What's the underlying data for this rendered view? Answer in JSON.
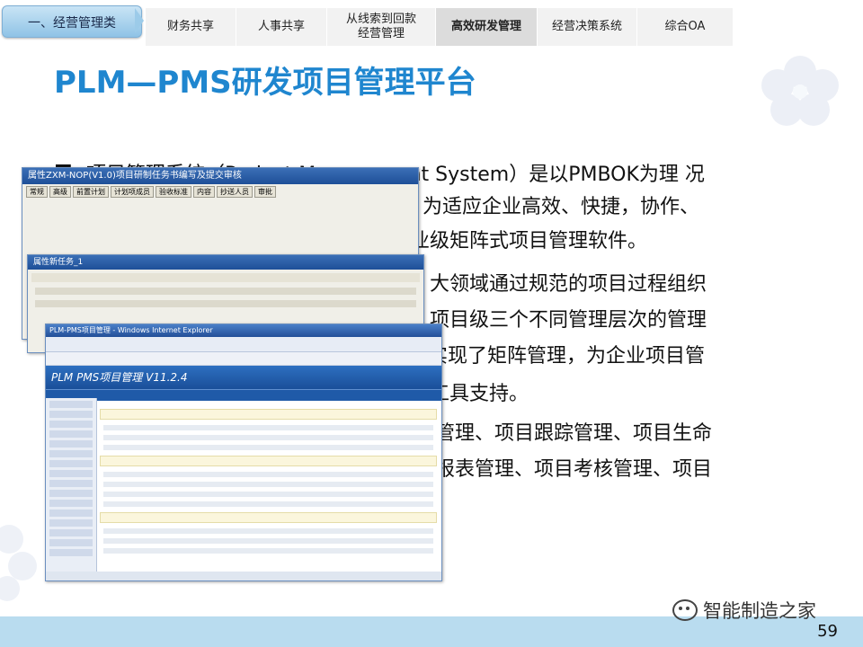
{
  "nav": {
    "section_label": "一、经营管理类",
    "tabs": [
      {
        "label": "财务共享"
      },
      {
        "label": "人事共享"
      },
      {
        "label": "从线索到回款\n经营管理"
      },
      {
        "label": "高效研发管理"
      },
      {
        "label": "经营决策系统"
      },
      {
        "label": "综合OA"
      }
    ],
    "active_tab": "高效研发管理"
  },
  "title": "PLM—PMS研发项目管理平台",
  "body": {
    "bullet": "■",
    "lines": [
      "项目管理系统（Project Management System）是以PMBOK为理 况",
      "为适应企业高效、快捷，协作、",
      "业级矩阵式项目管理软件。",
      "大领域通过规范的项目过程组织",
      "项目级三个不同管理层次的管理",
      "实现了矩阵管理，为企业项目管",
      "工具支持。",
      "管理、项目跟踪管理、项目生命",
      "报表管理、项目考核管理、项目"
    ]
  },
  "screenshot": {
    "win1_title": "属性ZXM-NOP(V1.0)项目研制任务书编写及提交审核",
    "win1_tabs": [
      "常规",
      "高级",
      "前置计划",
      "计划项成员",
      "验收标准",
      "内容",
      "抄送人员",
      "审批"
    ],
    "win2_title": "属性新任务_1",
    "ie_title": "PLM-PMS项目管理 - Windows Internet Explorer",
    "app_title": "PLM PMS项目管理 V11.2.4"
  },
  "watermark": "智能制造之家",
  "page_number": "59",
  "colors": {
    "title": "#1f86cf",
    "footer": "#b9dcef",
    "nav_active": "#8fc3e6"
  }
}
